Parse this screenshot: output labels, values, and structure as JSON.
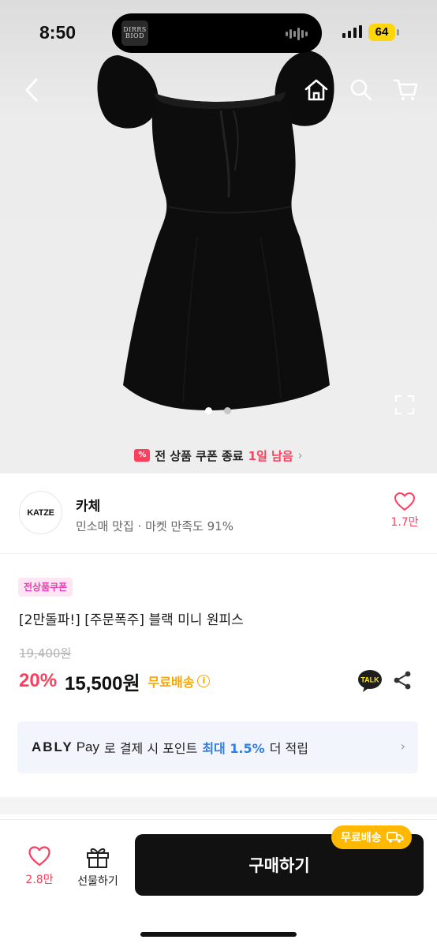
{
  "status_bar": {
    "time": "8:50",
    "battery": "64",
    "island_art_text": "DIRRS BIOD"
  },
  "nav": {
    "back_icon": "chevron-left-icon",
    "home_icon": "home-icon",
    "search_icon": "search-icon",
    "cart_icon": "cart-icon"
  },
  "gallery": {
    "total_images": 2,
    "current_index": 1
  },
  "coupon_banner": {
    "badge": "%",
    "text": "전 상품 쿠폰 종료",
    "remaining": "1일 남음"
  },
  "store": {
    "logo_text": "KATZE",
    "name": "카체",
    "subtitle": "민소매 맛집 · 마켓 만족도 91%",
    "like_count": "1.7만"
  },
  "product": {
    "badge": "전상품쿠폰",
    "title": "[2만돌파!] [주문폭주] 블랙 미니 원피스",
    "original_price": "19,400원",
    "discount": "20%",
    "price": "15,500원",
    "shipping": "무료배송",
    "shipping_info_icon": "i",
    "talk_label": "TALK"
  },
  "pay_banner": {
    "brand": "ABLY",
    "pay": "Pay",
    "text_before": "로 결제 시 포인트",
    "highlight": "최대 1.5%",
    "text_after": "더 적립"
  },
  "bottom_bar": {
    "like_count": "2.8만",
    "gift_label": "선물하기",
    "buy_label": "구매하기",
    "shipping_chip": "무료배송"
  },
  "colors": {
    "accent_pink": "#ff3d5c",
    "shipping_yellow": "#f6a700",
    "pay_blue": "#2f7de8",
    "buy_button": "#111111"
  }
}
